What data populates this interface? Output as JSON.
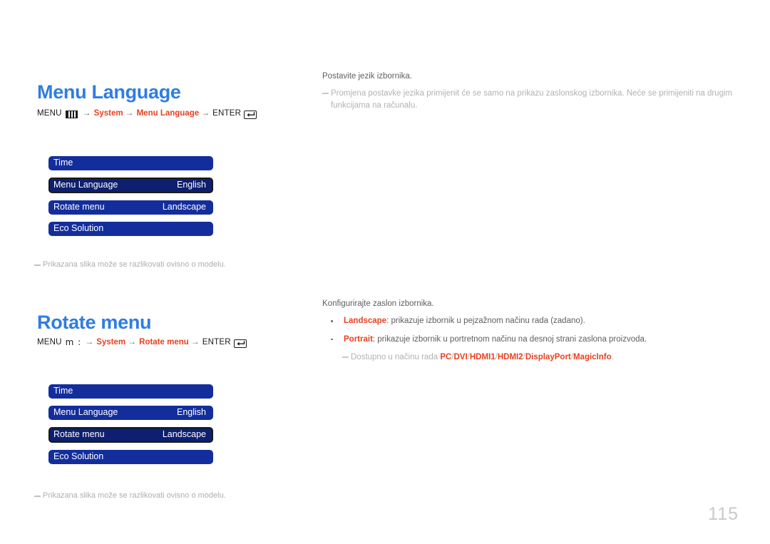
{
  "page": {
    "number": "115"
  },
  "sections": [
    {
      "title": "Menu Language",
      "breadcrumb": {
        "menu_label": "MENU",
        "menu_icon": "menu-bars-icon",
        "separator": "",
        "arrow": "→",
        "step1": "System",
        "step2": "Menu Language",
        "enter_label": "ENTER",
        "enter_icon": "enter-key-icon"
      },
      "osd": {
        "rows": [
          {
            "label": "Time",
            "value": "",
            "selected": false
          },
          {
            "label": "Menu Language",
            "value": "English",
            "selected": true
          },
          {
            "label": "Rotate menu",
            "value": "Landscape",
            "selected": false
          },
          {
            "label": "Eco Solution",
            "value": "",
            "selected": false
          }
        ],
        "note": "Prikazana slika može se razlikovati ovisno o modelu."
      },
      "description": {
        "lead": "Postavite jezik izbornika.",
        "note": "Promjena postavke jezika primijenit će se samo na prikazu zaslonskog izbornika. Neće se primijeniti na drugim funkcijama na računalu."
      }
    },
    {
      "title": "Rotate menu",
      "breadcrumb": {
        "menu_label": "MENU",
        "menu_icon": "menu-glyph-icon",
        "separator": "m  :",
        "arrow": "→",
        "step1": "System",
        "step2": "Rotate menu",
        "enter_label": "ENTER",
        "enter_icon": "enter-key-icon"
      },
      "osd": {
        "rows": [
          {
            "label": "Time",
            "value": "",
            "selected": false
          },
          {
            "label": "Menu Language",
            "value": "English",
            "selected": false
          },
          {
            "label": "Rotate menu",
            "value": "Landscape",
            "selected": true
          },
          {
            "label": "Eco Solution",
            "value": "",
            "selected": false
          }
        ],
        "note": "Prikazana slika može se razlikovati ovisno o modelu."
      },
      "description": {
        "lead": "Konfigurirajte zaslon izbornika.",
        "bullets": [
          {
            "term": "Landscape",
            "text": ": prikazuje izbornik u pejzažnom načinu rada (zadano)."
          },
          {
            "term": "Portrait",
            "text": ": prikazuje izbornik u portretnom načinu na desnoj strani zaslona proizvoda."
          }
        ],
        "sub_note_prefix": "Dostupno u načinu rada ",
        "sub_note_sources": [
          "PC",
          "DVI",
          "HDMI1",
          "HDMI2",
          "DisplayPort",
          "MagicInfo"
        ],
        "sub_note_suffix": "."
      }
    }
  ],
  "colors": {
    "heading_blue": "#2f7de1",
    "accent_red": "#e8401f",
    "osd_blue": "#132e9c",
    "osd_selected_blue": "#0d1f6e",
    "muted_gray": "#b2b2b2",
    "page_number_gray": "#c9c9c9"
  }
}
